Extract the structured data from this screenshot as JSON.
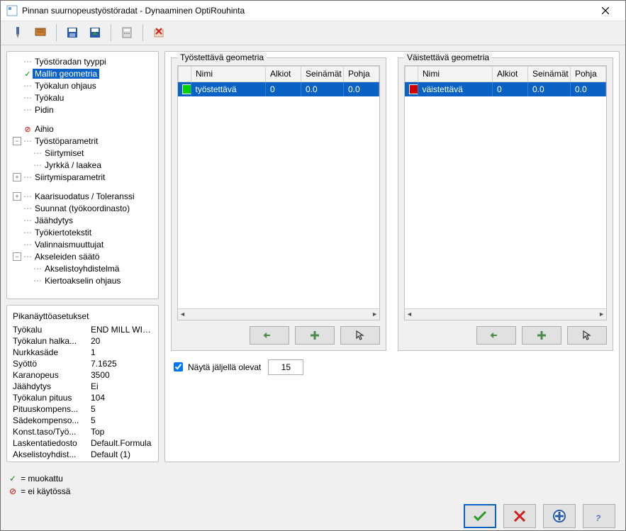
{
  "window": {
    "title": "Pinnan suurnopeustyöstöradat - Dynaaminen OptiRouhinta"
  },
  "tree": {
    "items": [
      {
        "label": "Työstöradan tyyppi"
      },
      {
        "label": "Mallin geometria"
      },
      {
        "label": "Työkalun ohjaus"
      },
      {
        "label": "Työkalu"
      },
      {
        "label": "Pidin"
      },
      {
        "label": "Aihio"
      },
      {
        "label": "Työstöparametrit"
      },
      {
        "label": "Siirtymiset"
      },
      {
        "label": "Jyrkkä / laakea"
      },
      {
        "label": "Siirtymisparametrit"
      },
      {
        "label": "Kaarisuodatus / Toleranssi"
      },
      {
        "label": "Suunnat (työkoordinasto)"
      },
      {
        "label": "Jäähdytys"
      },
      {
        "label": "Työkiertotekstit"
      },
      {
        "label": "Valinnaismuuttujat"
      },
      {
        "label": "Akseleiden säätö"
      },
      {
        "label": "Akselistoyhdistelmä"
      },
      {
        "label": "Kiertoakselin ohjaus"
      }
    ]
  },
  "quick": {
    "title": "Pikanäyttöasetukset",
    "rows": [
      {
        "k": "Työkalu",
        "v": "END MILL WITH ..."
      },
      {
        "k": "Työkalun halka...",
        "v": "20"
      },
      {
        "k": "Nurkkasäde",
        "v": "1"
      },
      {
        "k": "Syöttö",
        "v": "7.1625"
      },
      {
        "k": "Karanopeus",
        "v": "3500"
      },
      {
        "k": "Jäähdytys",
        "v": "Ei"
      },
      {
        "k": "Työkalun pituus",
        "v": "104"
      },
      {
        "k": "Pituuskompens...",
        "v": "5"
      },
      {
        "k": "Sädekompenso...",
        "v": "5"
      },
      {
        "k": "Konst.taso/Työ...",
        "v": "Top"
      },
      {
        "k": "Laskentatiedosto",
        "v": "Default.Formula"
      },
      {
        "k": "Akselistoyhdist...",
        "v": "Default (1)"
      }
    ]
  },
  "geom": {
    "left": {
      "legend": "Työstettävä geometria",
      "headers": {
        "name": "Nimi",
        "alkiot": "Alkiot",
        "seinamat": "Seinämät",
        "pohja": "Pohja"
      },
      "row": {
        "color": "#00d000",
        "name": "työstettävä",
        "alkiot": "0",
        "seinamat": "0.0",
        "pohja": "0.0"
      }
    },
    "right": {
      "legend": "Väistettävä geometria",
      "headers": {
        "name": "Nimi",
        "alkiot": "Alkiot",
        "seinamat": "Seinämät",
        "pohja": "Pohja"
      },
      "row": {
        "color": "#d00000",
        "name": "väistettävä",
        "alkiot": "0",
        "seinamat": "0.0",
        "pohja": "0.0"
      }
    }
  },
  "showRemaining": {
    "label": "Näytä jäljellä olevat",
    "value": "15"
  },
  "legend": {
    "modified": "= muokattu",
    "disabled": "= ei käytössä"
  }
}
